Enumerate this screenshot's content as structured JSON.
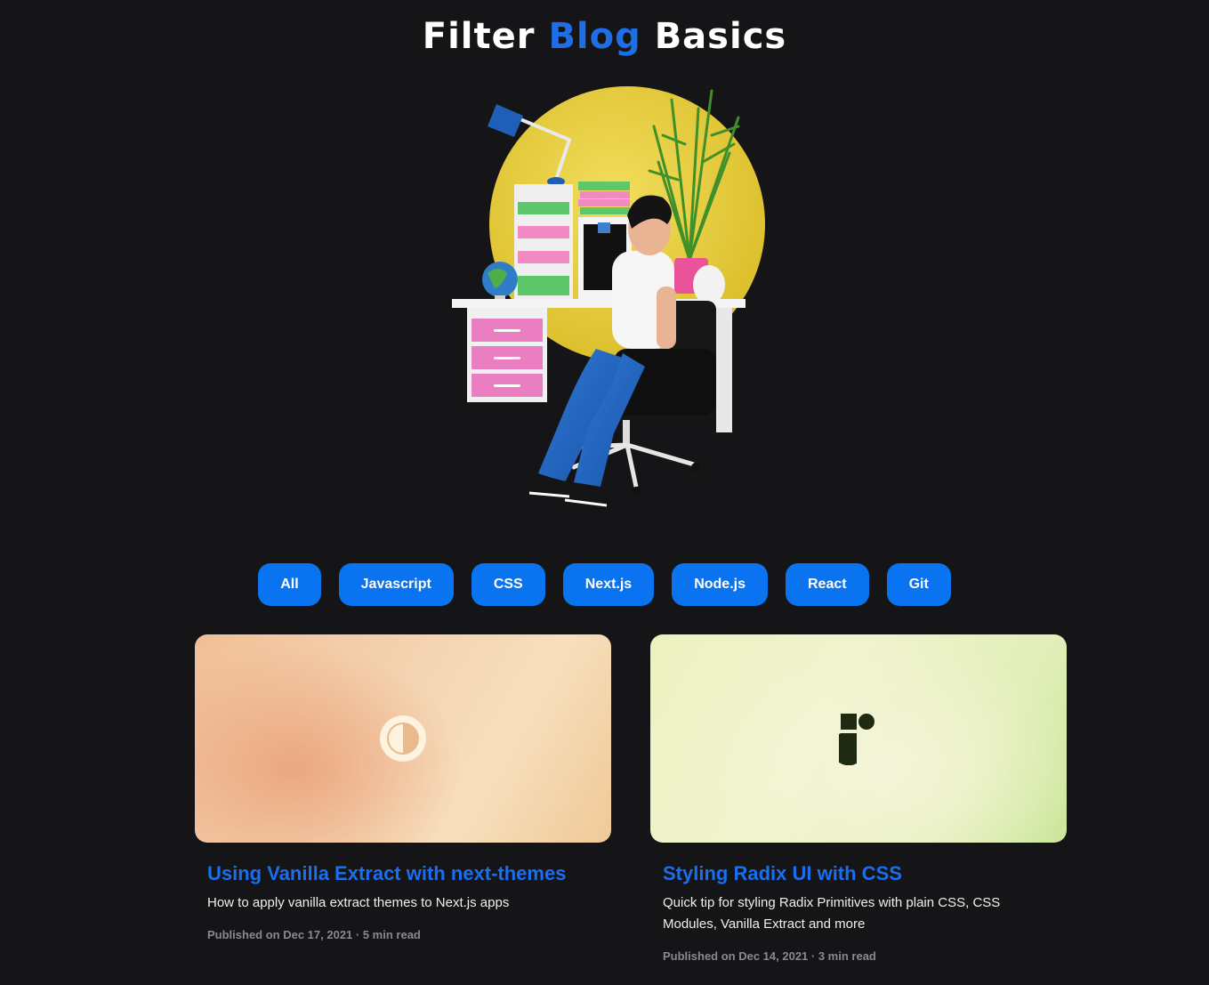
{
  "header": {
    "title_part1": "Filter",
    "title_accent": "Blog",
    "title_part2": "Basics",
    "accent_color": "#1e6ee8"
  },
  "hero": {
    "illustration": "person-at-desk-illustration"
  },
  "filters": {
    "items": [
      {
        "label": "All"
      },
      {
        "label": "Javascript"
      },
      {
        "label": "CSS"
      },
      {
        "label": "Next.js"
      },
      {
        "label": "Node.js"
      },
      {
        "label": "React"
      },
      {
        "label": "Git"
      }
    ],
    "color": "#0a73f0"
  },
  "posts": [
    {
      "title": "Using Vanilla Extract with next-themes",
      "description": "How to apply vanilla extract themes to Next.js apps",
      "meta": "Published on Dec 17, 2021 · 5 min read",
      "cover_icon": "half-circle-theme-icon"
    },
    {
      "title": "Styling Radix UI with CSS",
      "description": "Quick tip for styling Radix Primitives with plain CSS, CSS Modules, Vanilla Extract and more",
      "meta": "Published on Dec 14, 2021 · 3 min read",
      "cover_icon": "radix-logo-icon"
    }
  ]
}
